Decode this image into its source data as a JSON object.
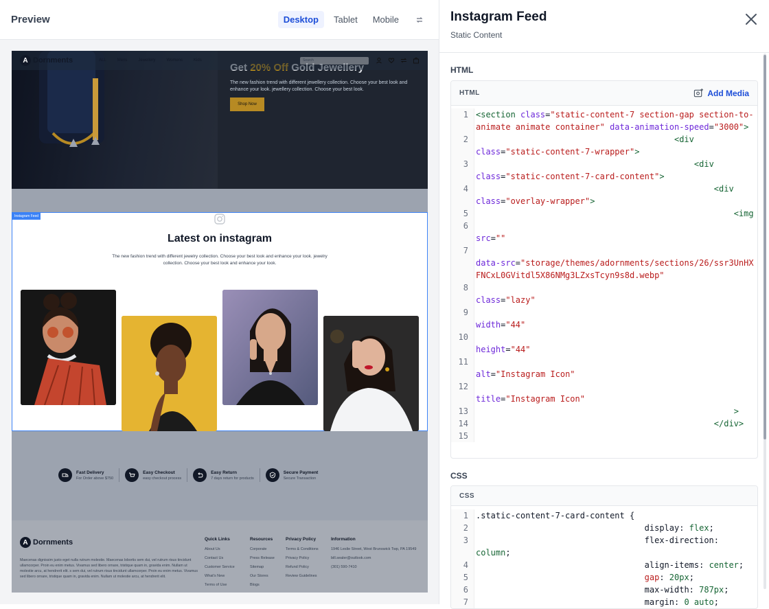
{
  "preview": {
    "title": "Preview",
    "devices": [
      "Desktop",
      "Tablet",
      "Mobile"
    ],
    "active_device": "Desktop"
  },
  "site": {
    "logo_letter": "A",
    "logo_text": "Dornments",
    "nav_links": [
      "ALL",
      "Mens",
      "Jewellery",
      "Womens",
      "Kids"
    ],
    "search_placeholder": "Search",
    "hero_title_pre": "Get ",
    "hero_title_highlight": "20% Off",
    "hero_title_post": " Gold Jewellery",
    "hero_desc": "The new fashion trend with different jewellery collection. Choose your best look and enhance your look. jewellery collection. Choose your best look.",
    "hero_button": "Shop Now",
    "section_badge": "Instagram Feed",
    "insta_heading": "Latest on instagram",
    "insta_desc": "The new fashion trend with different jewelry collection. Choose your best look and enhance your look. jewelry collection. Choose your best look and enhance your look.",
    "features": [
      {
        "title": "Fast Delivery",
        "sub": "For Order above $750"
      },
      {
        "title": "Easy Checkout",
        "sub": "easy checkout process"
      },
      {
        "title": "Easy Return",
        "sub": "7 days return for products"
      },
      {
        "title": "Secure Payment",
        "sub": "Secure Transaction"
      }
    ],
    "footer_about": "Maecenas dignissim justo eget nulla rutrum molestie. Maecenas lobortis sem dui, vel rutrum risus tincidunt ullamcorper. Proin eu enim metus. Vivamus sed libero ornare, tristique quam in, gravida enim. Nullam ut molestie arcu, at hendrerit elit. s sem dui, vel rutrum risus tincidunt ullamcorper. Proin eu enim metus. Vivamus sed libero ornare, tristique quam in, gravida enim. Nullam ut molestie arcu, at hendrerit elit.",
    "footer_cols": [
      {
        "title": "Quick Links",
        "items": [
          "About Us",
          "Contact Us",
          "Customer Service",
          "What's New",
          "Terms of Use"
        ]
      },
      {
        "title": "Resources",
        "items": [
          "Corporate",
          "Press Release",
          "Sitemap",
          "Our Stores",
          "Blogs"
        ]
      },
      {
        "title": "Privacy Policy",
        "items": [
          "Terms & Conditions",
          "Privacy Policy",
          "Refund Policy",
          "Review Guidelines"
        ]
      },
      {
        "title": "Information",
        "items": [
          "1946 Leslie Street, West Brunswick Twp, PA 19549",
          "bill.sealer@outlook.com",
          "(301) 590-7410"
        ]
      }
    ]
  },
  "editor": {
    "title": "Instagram Feed",
    "subtitle": "Static Content",
    "html_label": "HTML",
    "html_box_label": "HTML",
    "add_media": "Add Media",
    "css_label": "CSS",
    "css_box_label": "CSS"
  },
  "colors": {
    "accent": "#1d4ed8",
    "selection": "#3b82f6",
    "gold": "#b78a23"
  }
}
